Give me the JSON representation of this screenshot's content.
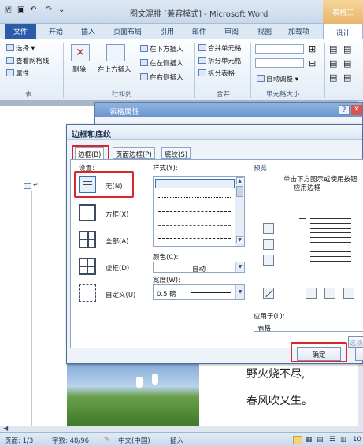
{
  "window": {
    "title": "图文混排 [兼容模式] - Microsoft Word",
    "context_tab_group": "表格工"
  },
  "ribbon_tabs": [
    "文件",
    "开始",
    "插入",
    "页面布局",
    "引用",
    "邮件",
    "审阅",
    "视图",
    "加载项",
    "设计"
  ],
  "ribbon": {
    "table_group": {
      "select": "选择",
      "view_gridlines": "查看网格线",
      "properties": "属性",
      "group_label": "表"
    },
    "rows_cols_group": {
      "delete": "删除",
      "insert_above": "在上方插入",
      "insert_below": "在下方插入",
      "insert_left": "在左侧插入",
      "insert_right": "在右侧插入",
      "group_label": "行和列"
    },
    "merge_group": {
      "merge_cells": "合并单元格",
      "split_cells": "拆分单元格",
      "split_table": "拆分表格",
      "group_label": "合并"
    },
    "cell_size_group": {
      "autofit": "自动调整",
      "group_label": "单元格大小"
    }
  },
  "table_properties_dialog": {
    "title": "表格属性",
    "help": "?",
    "close": "✕"
  },
  "borders_dialog": {
    "title": "边框和底纹",
    "tabs": [
      "边框(B)",
      "页面边框(P)",
      "底纹(S)"
    ],
    "setting_label": "设置:",
    "settings": [
      "无(N)",
      "方框(X)",
      "全部(A)",
      "虚框(D)",
      "自定义(U)"
    ],
    "style_label": "样式(Y):",
    "color_label": "颜色(C):",
    "color_value": "自动",
    "width_label": "宽度(W):",
    "width_value": "0.5 磅",
    "preview_label": "预览",
    "preview_hint_line1": "单击下方图示或使用按钮",
    "preview_hint_line2": "应用边框",
    "apply_to_label": "应用于(L):",
    "apply_to_value": "表格",
    "options_button": "选项",
    "ok_button": "确定"
  },
  "document": {
    "poem_line1": "野火烧不尽,",
    "poem_line2": "春风吹又生。",
    "paragraph_mark": "↵"
  },
  "statusbar": {
    "page": "页面: 1/3",
    "word_count": "字数: 48/96",
    "language": "中文(中国)",
    "insert_mode": "插入",
    "zoom": "10"
  },
  "colors": {
    "highlight": "#d7262e",
    "file_tab": "#2a5caa"
  }
}
